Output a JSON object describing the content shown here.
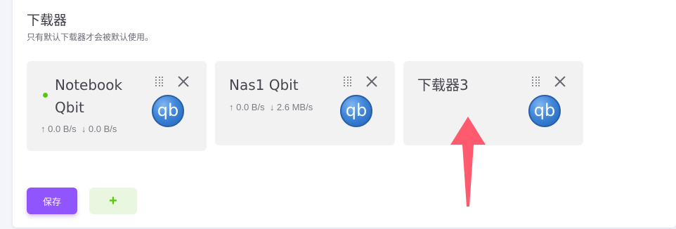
{
  "section": {
    "title": "下载器",
    "subtitle": "只有默认下载器才会被默认使用。"
  },
  "downloaders": [
    {
      "name_line1": "Notebook",
      "name_line2": "Qbit",
      "upload": "↑ 0.0 B/s",
      "download": "↓ 0.0 B/s",
      "default": true,
      "logo": "qb"
    },
    {
      "name_line1": "Nas1 Qbit",
      "name_line2": "",
      "upload": "↑ 0.0 B/s",
      "download": "↓ 2.6 MB/s",
      "default": false,
      "logo": "qb"
    },
    {
      "name_line1": "下载器3",
      "name_line2": "",
      "upload": "",
      "download": "",
      "default": false,
      "logo": "qb"
    }
  ],
  "actions": {
    "save_label": "保存",
    "add_label": "+"
  },
  "colors": {
    "accent": "#9155fd",
    "success": "#56ca00",
    "card_bg": "#f2f2f2",
    "annotation_arrow": "#ff5a6e"
  },
  "icons": {
    "drag": "drag-handle-icon",
    "close": "close-icon",
    "logo": "qbittorrent-logo-icon",
    "status": "status-dot-icon"
  }
}
